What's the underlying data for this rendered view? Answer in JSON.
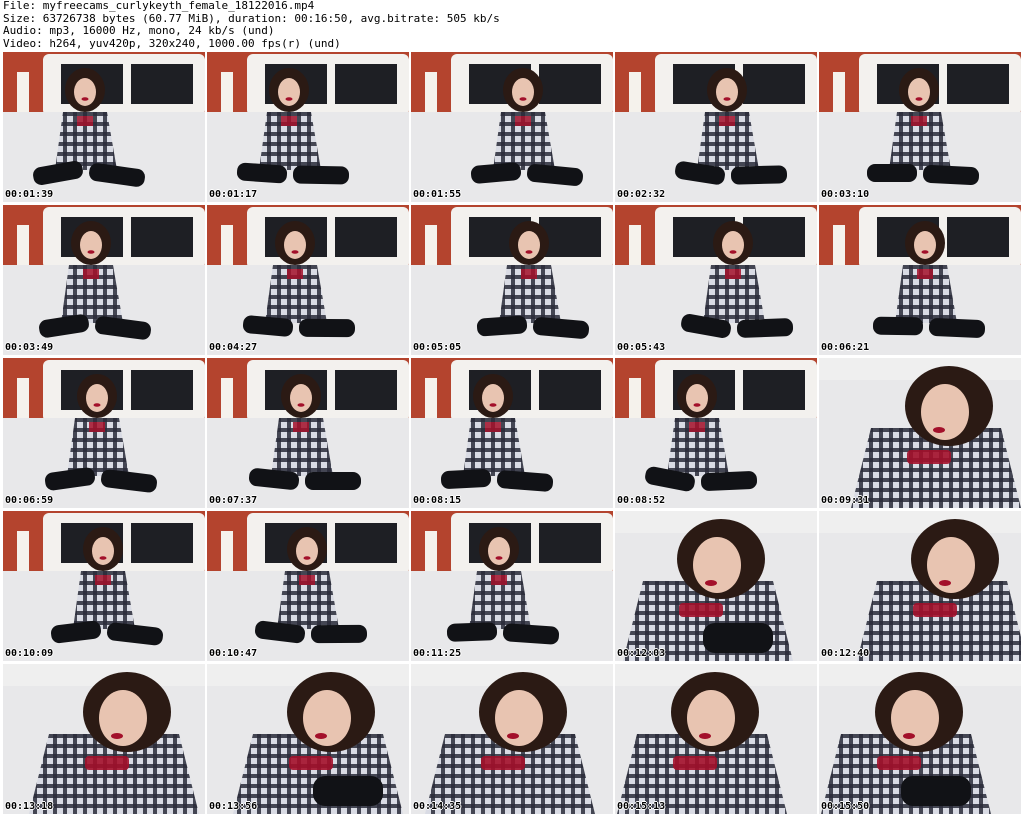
{
  "header": {
    "file": "File: myfreecams_curlykeyth_female_18122016.mp4",
    "size": "Size: 63726738 bytes (60.77 MiB), duration: 00:16:50, avg.bitrate: 505 kb/s",
    "audio": "Audio: mp3, 16000 Hz, mono, 24 kb/s (und)",
    "video": "Video: h264, yuv420p, 320x240, 1000.00 fps(r) (und)"
  },
  "thumbnails": [
    {
      "time": "00:01:39",
      "scene": "bedroom-frame-icon"
    },
    {
      "time": "00:01:17",
      "scene": "bedroom-frame-icon"
    },
    {
      "time": "00:01:55",
      "scene": "bedroom-frame-icon"
    },
    {
      "time": "00:02:32",
      "scene": "bedroom-frame-icon"
    },
    {
      "time": "00:03:10",
      "scene": "bedroom-frame-icon"
    },
    {
      "time": "00:03:49",
      "scene": "bedroom-frame-icon"
    },
    {
      "time": "00:04:27",
      "scene": "bedroom-frame-icon"
    },
    {
      "time": "00:05:05",
      "scene": "bedroom-frame-icon"
    },
    {
      "time": "00:05:43",
      "scene": "bedroom-frame-icon"
    },
    {
      "time": "00:06:21",
      "scene": "bedroom-frame-icon"
    },
    {
      "time": "00:06:59",
      "scene": "bedroom-frame-icon"
    },
    {
      "time": "00:07:37",
      "scene": "bedroom-frame-icon"
    },
    {
      "time": "00:08:15",
      "scene": "bedroom-frame-icon"
    },
    {
      "time": "00:08:52",
      "scene": "bedroom-frame-icon"
    },
    {
      "time": "00:09:31",
      "scene": "closeup-frame-icon"
    },
    {
      "time": "00:10:09",
      "scene": "bedroom-frame-icon"
    },
    {
      "time": "00:10:47",
      "scene": "bedroom-frame-icon"
    },
    {
      "time": "00:11:25",
      "scene": "bedroom-frame-icon"
    },
    {
      "time": "00:12:03",
      "scene": "closeup-frame-icon"
    },
    {
      "time": "00:12:40",
      "scene": "closeup-frame-icon"
    },
    {
      "time": "00:13:18",
      "scene": "closeup-frame-icon"
    },
    {
      "time": "00:13:56",
      "scene": "closeup-frame-icon"
    },
    {
      "time": "00:14:35",
      "scene": "closeup-frame-icon"
    },
    {
      "time": "00:15:13",
      "scene": "closeup-frame-icon"
    },
    {
      "time": "00:15:50",
      "scene": "closeup-frame-icon"
    }
  ],
  "colors": {
    "wall": "#b4442e",
    "headboard": "#f3f1ee",
    "headboard_panel": "#1e1f24",
    "bed": "#e8e8ea",
    "shirt_dark": "#2a2c3a",
    "shirt_light": "#d9dbe4",
    "stockings": "#111216",
    "hair": "#2b1a14",
    "skin": "#e8c4b1",
    "lips": "#a3102a"
  }
}
